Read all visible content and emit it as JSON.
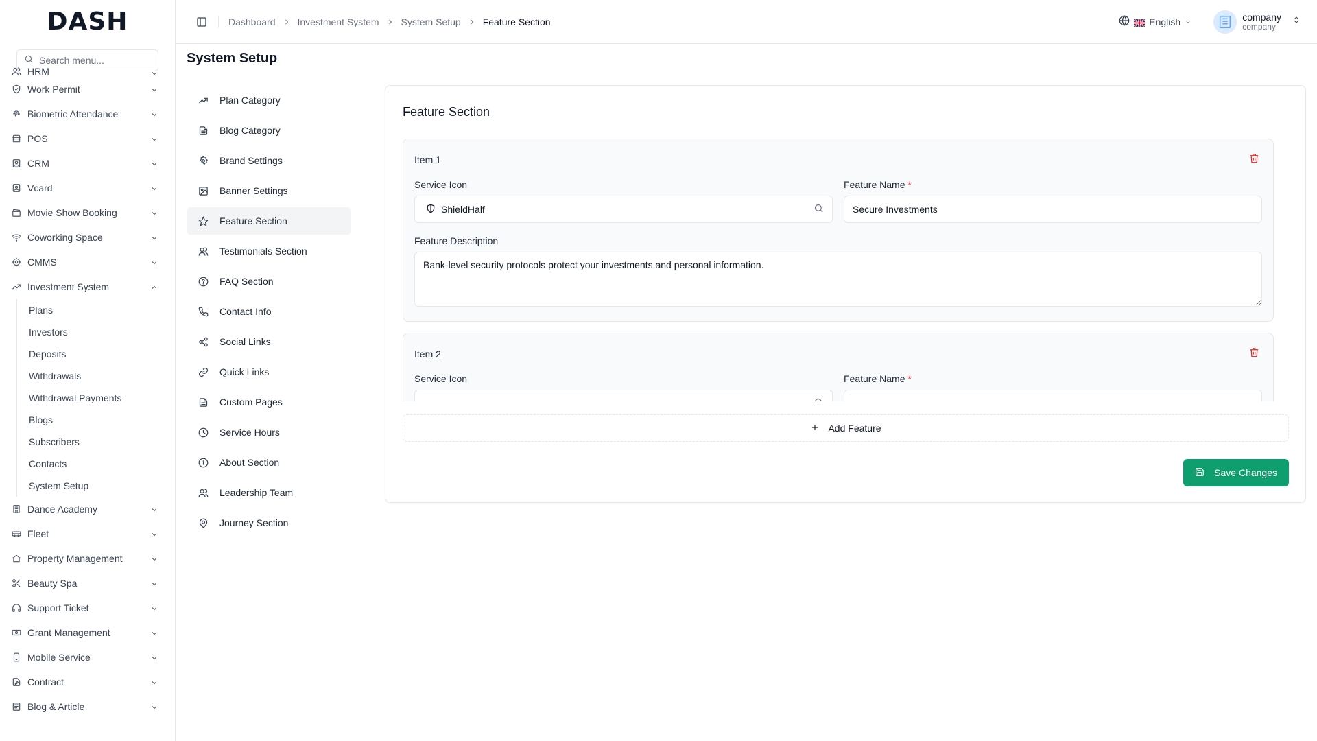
{
  "brand": {
    "logo_text": "DASH"
  },
  "search": {
    "placeholder": "Search menu..."
  },
  "sidebar": {
    "partial_item": "HRM",
    "items_top": [
      {
        "label": "Work Permit",
        "icon": "shield-check-icon"
      },
      {
        "label": "Biometric Attendance",
        "icon": "fingerprint-icon"
      },
      {
        "label": "POS",
        "icon": "store-icon"
      },
      {
        "label": "CRM",
        "icon": "contact-icon"
      },
      {
        "label": "Vcard",
        "icon": "id-card-icon"
      },
      {
        "label": "Movie Show Booking",
        "icon": "clapperboard-icon"
      },
      {
        "label": "Coworking Space",
        "icon": "wifi-icon"
      },
      {
        "label": "CMMS",
        "icon": "cog-icon"
      }
    ],
    "expanded": {
      "label": "Investment System",
      "icon": "trending-up-icon",
      "children": [
        "Plans",
        "Investors",
        "Deposits",
        "Withdrawals",
        "Withdrawal Payments",
        "Blogs",
        "Subscribers",
        "Contacts",
        "System Setup"
      ]
    },
    "items_bottom": [
      {
        "label": "Dance Academy",
        "icon": "building-icon"
      },
      {
        "label": "Fleet",
        "icon": "truck-icon"
      },
      {
        "label": "Property Management",
        "icon": "home-icon"
      },
      {
        "label": "Beauty Spa",
        "icon": "scissors-icon"
      },
      {
        "label": "Support Ticket",
        "icon": "headphones-icon"
      },
      {
        "label": "Grant Management",
        "icon": "banknote-icon"
      },
      {
        "label": "Mobile Service",
        "icon": "smartphone-icon"
      },
      {
        "label": "Contract",
        "icon": "file-pen-icon"
      },
      {
        "label": "Blog & Article",
        "icon": "newspaper-icon"
      }
    ]
  },
  "breadcrumb": [
    "Dashboard",
    "Investment System",
    "System Setup",
    "Feature Section"
  ],
  "header": {
    "language": "English",
    "user_name": "company",
    "user_role": "company"
  },
  "page": {
    "title": "System Setup"
  },
  "settings_nav": [
    {
      "label": "Plan Category",
      "icon": "trending-up-icon",
      "active": false
    },
    {
      "label": "Blog Category",
      "icon": "file-text-icon",
      "active": false
    },
    {
      "label": "Brand Settings",
      "icon": "gear-icon",
      "active": false
    },
    {
      "label": "Banner Settings",
      "icon": "image-icon",
      "active": false
    },
    {
      "label": "Feature Section",
      "icon": "star-icon",
      "active": true
    },
    {
      "label": "Testimonials Section",
      "icon": "users-icon",
      "active": false
    },
    {
      "label": "FAQ Section",
      "icon": "help-circle-icon",
      "active": false
    },
    {
      "label": "Contact Info",
      "icon": "phone-icon",
      "active": false
    },
    {
      "label": "Social Links",
      "icon": "share-icon",
      "active": false
    },
    {
      "label": "Quick Links",
      "icon": "link-icon",
      "active": false
    },
    {
      "label": "Custom Pages",
      "icon": "file-text-icon",
      "active": false
    },
    {
      "label": "Service Hours",
      "icon": "clock-icon",
      "active": false
    },
    {
      "label": "About Section",
      "icon": "info-icon",
      "active": false
    },
    {
      "label": "Leadership Team",
      "icon": "users-icon",
      "active": false
    },
    {
      "label": "Journey Section",
      "icon": "map-pin-icon",
      "active": false
    }
  ],
  "feature_section": {
    "title": "Feature Section",
    "labels": {
      "service_icon": "Service Icon",
      "feature_name": "Feature Name",
      "required_mark": "*",
      "feature_description": "Feature Description"
    },
    "items": [
      {
        "title": "Item 1",
        "service_icon": "ShieldHalf",
        "feature_name": "Secure Investments",
        "feature_description": "Bank-level security protocols protect your investments and personal information."
      },
      {
        "title": "Item 2",
        "service_icon": "",
        "feature_name": "",
        "feature_description": ""
      }
    ],
    "add_label": "Add Feature",
    "save_label": "Save Changes"
  },
  "colors": {
    "primary": "#0f9f6e",
    "danger": "#dc2626",
    "border": "#e5e7eb",
    "active_bg": "#f3f4f6"
  }
}
